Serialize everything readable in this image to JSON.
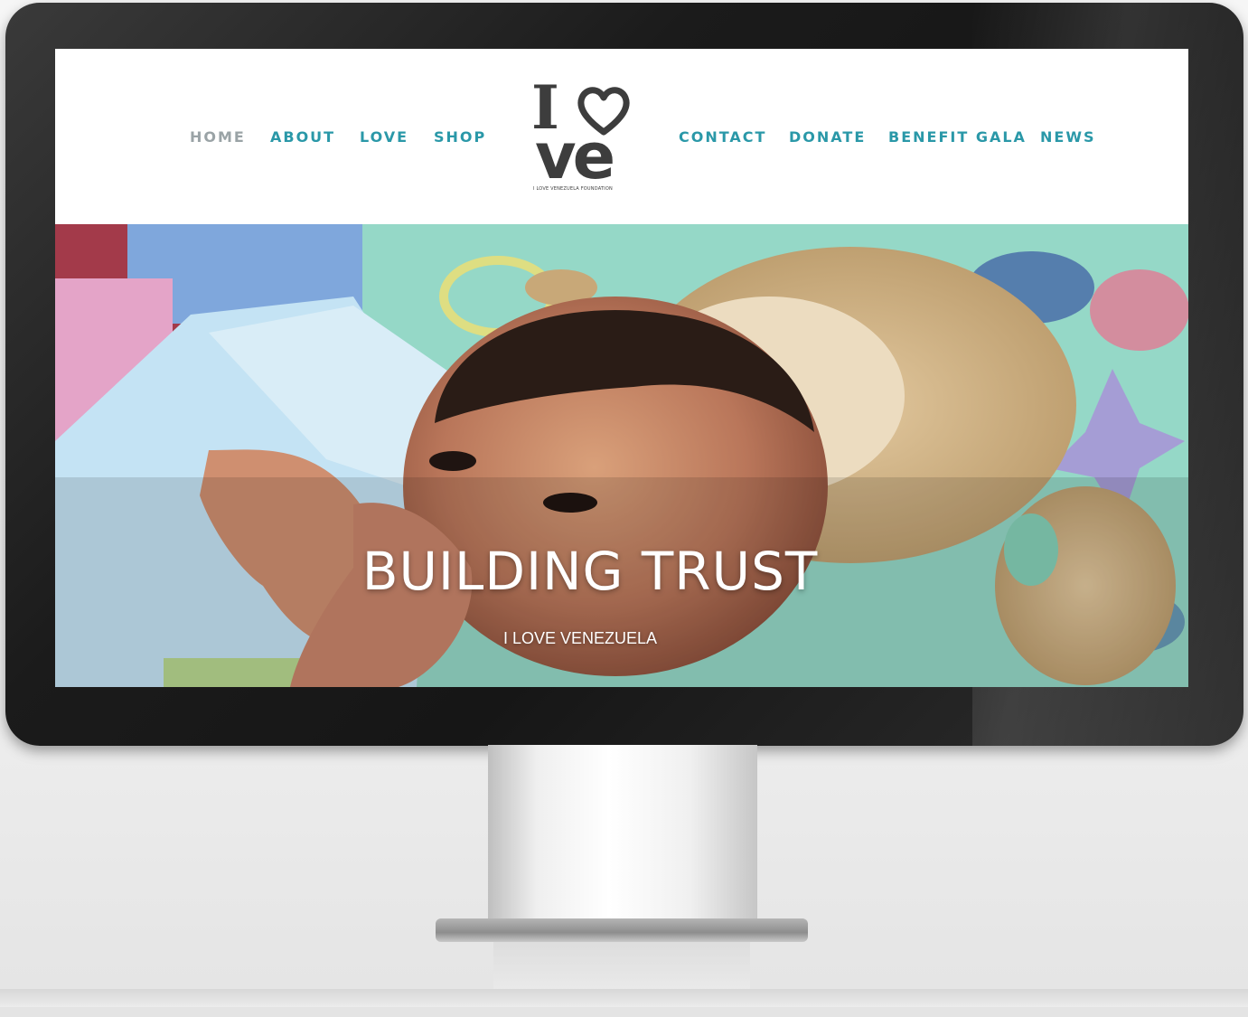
{
  "nav": {
    "left": [
      {
        "label": "HOME",
        "active": true
      },
      {
        "label": "ABOUT"
      },
      {
        "label": "LOVE"
      },
      {
        "label": "SHOP"
      }
    ],
    "right": [
      {
        "label": "CONTACT"
      },
      {
        "label": "DONATE"
      },
      {
        "label": "BENEFIT GALA"
      },
      {
        "label": "NEWS"
      }
    ]
  },
  "logo": {
    "line1": "I",
    "line2": "ve",
    "tagline": "I LOVE VENEZUELA FOUNDATION"
  },
  "hero": {
    "title": "BUILDING TRUST",
    "subtitle": "I LOVE VENEZUELA"
  },
  "colors": {
    "nav_link": "#2a98a8",
    "nav_active": "#9aa3a6",
    "logo": "#3d3d3d",
    "bezel": "#1b1b1b"
  }
}
